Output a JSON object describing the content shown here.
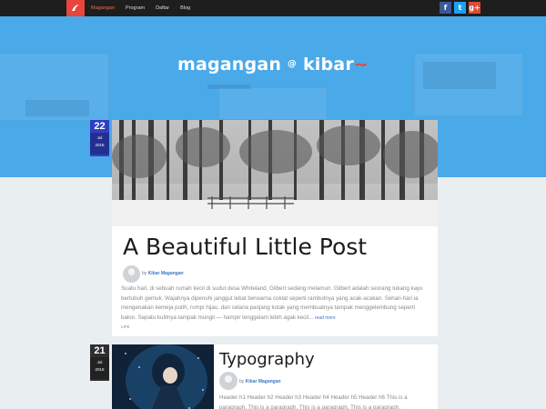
{
  "nav": {
    "items": [
      "Magangan",
      "Program",
      "Daftar",
      "Blog"
    ],
    "active_index": 0
  },
  "social": [
    "f",
    "t",
    "g+"
  ],
  "brand": {
    "name": "magangan",
    "at": "@",
    "partner": "kibar"
  },
  "colors": {
    "hero": "#4aa9e8",
    "accent": "#e8453c",
    "link": "#3a78c3"
  },
  "posts": [
    {
      "day": "22",
      "month": "Jul",
      "year": "2016",
      "title": "A Beautiful Little Post",
      "author_prefix": "by",
      "author": "Kibar Magangan",
      "excerpt": "Suatu hari, di sebuah rumah kecil di sudut desa Whiteland, Gilbert sedang melamun. Gilbert adalah seorang tukang kayu bertubuh gemuk. Wajahnya dipenuhi janggut lebat berwarna coklat seperti rambutnya yang acak-acakan. Sehari-hari ia mengenakan kemeja putih, rompi hijau, dan celana panjang kotak yang membuatnya tampak menggelembung seperti balon. Sepatu kulitnya tampak mungil — hampir tenggelam lebih agak kecil...",
      "read_more": "read more",
      "tag": "LIFE"
    },
    {
      "day": "21",
      "month": "Jul",
      "year": "2016",
      "title": "Typography",
      "author_prefix": "by",
      "author": "Kibar Magangan",
      "excerpt": "Header h1 Header h2 Header h3 Header h4 Header h5 Header h6 This is a paragraph. This is a paragraph. This is a paragraph. This is a paragraph."
    }
  ]
}
